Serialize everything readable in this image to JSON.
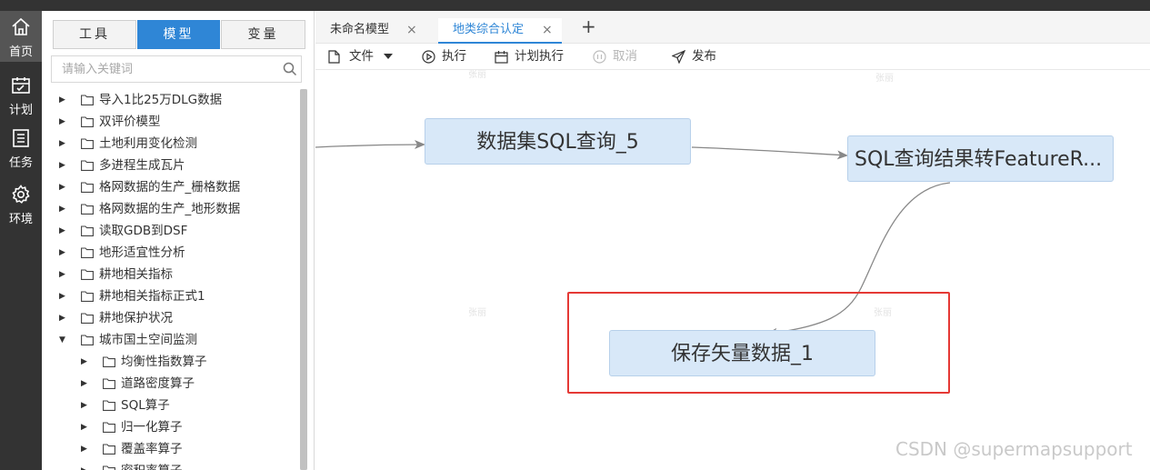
{
  "nav": {
    "items": [
      {
        "label": "首页",
        "icon": "home-icon",
        "active": true
      },
      {
        "label": "计划",
        "icon": "calendar-icon",
        "active": false
      },
      {
        "label": "任务",
        "icon": "list-icon",
        "active": false
      },
      {
        "label": "环境",
        "icon": "gear-icon",
        "active": false
      }
    ]
  },
  "panel": {
    "tabs": [
      "工具",
      "模型",
      "变量"
    ],
    "active_tab": "模型",
    "search_placeholder": "请输入关键词",
    "tree": [
      {
        "label": "导入1比25万DLG数据",
        "level": 0,
        "expanded": false
      },
      {
        "label": "双评价模型",
        "level": 0,
        "expanded": false
      },
      {
        "label": "土地利用变化检测",
        "level": 0,
        "expanded": false
      },
      {
        "label": "多进程生成瓦片",
        "level": 0,
        "expanded": false
      },
      {
        "label": "格网数据的生产_栅格数据",
        "level": 0,
        "expanded": false
      },
      {
        "label": "格网数据的生产_地形数据",
        "level": 0,
        "expanded": false
      },
      {
        "label": "读取GDB到DSF",
        "level": 0,
        "expanded": false
      },
      {
        "label": "地形适宜性分析",
        "level": 0,
        "expanded": false
      },
      {
        "label": "耕地相关指标",
        "level": 0,
        "expanded": false
      },
      {
        "label": "耕地相关指标正式1",
        "level": 0,
        "expanded": false
      },
      {
        "label": "耕地保护状况",
        "level": 0,
        "expanded": false
      },
      {
        "label": "城市国土空间监测",
        "level": 0,
        "expanded": true
      },
      {
        "label": "均衡性指数算子",
        "level": 1,
        "expanded": false
      },
      {
        "label": "道路密度算子",
        "level": 1,
        "expanded": false
      },
      {
        "label": "SQL算子",
        "level": 1,
        "expanded": false
      },
      {
        "label": "归一化算子",
        "level": 1,
        "expanded": false
      },
      {
        "label": "覆盖率算子",
        "level": 1,
        "expanded": false
      },
      {
        "label": "密积率算子",
        "level": 1,
        "expanded": false
      }
    ]
  },
  "doc_tabs": [
    {
      "label": "未命名模型",
      "active": false
    },
    {
      "label": "地类综合认定",
      "active": true
    }
  ],
  "add_tab": "+",
  "close_glyph": "×",
  "toolbar": {
    "file": "文件",
    "run": "执行",
    "schedule": "计划执行",
    "cancel": "取消",
    "publish": "发布"
  },
  "canvas": {
    "nodes": {
      "sql_query": "数据集SQL查询_5",
      "to_feature": "SQL查询结果转FeatureR...",
      "save_vector": "保存矢量数据_1"
    },
    "watermark": "张丽",
    "credit": "CSDN @supermapsupport"
  },
  "colors": {
    "accent": "#2f86d6",
    "nav_bg": "#333333",
    "node_fill": "#d8e8f8",
    "highlight": "#e53935"
  }
}
